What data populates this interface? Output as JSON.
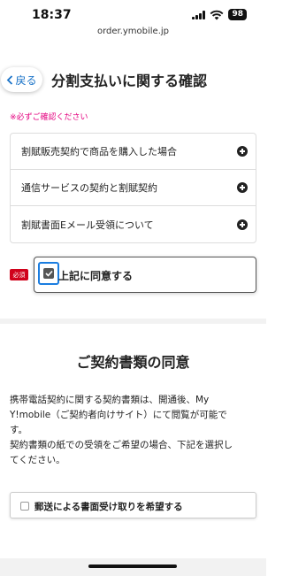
{
  "status": {
    "time": "18:37",
    "battery": "98"
  },
  "browser": {
    "url": "order.ymobile.jp"
  },
  "installment": {
    "back_label": "戻る",
    "title": "分割支払いに関する確認",
    "required_note": "※必ずご確認ください",
    "items": [
      {
        "label": "割賦販売契約で商品を購入した場合"
      },
      {
        "label": "通信サービスの契約と割賦契約"
      },
      {
        "label": "割賦書面Eメール受領について"
      }
    ],
    "required_badge": "必須",
    "agree_label": "上記に同意する",
    "agree_checked": true
  },
  "contract_docs": {
    "title": "ご契約書類の同意",
    "description_lines": [
      "携帯電話契約に関する契約書類は、開通後、My",
      "Y!mobile（ご契約者向けサイト）にて閲覧が可能で",
      "す。",
      "契約書類の紙での受領をご希望の場合、下記を選択し",
      "てください。"
    ],
    "mail_option_label": "郵送による書面受け取りを希望する",
    "mail_option_checked": false
  },
  "colors": {
    "accent_blue": "#1a7de0",
    "required_pink": "#e4007f",
    "badge_red": "#d0021b"
  }
}
